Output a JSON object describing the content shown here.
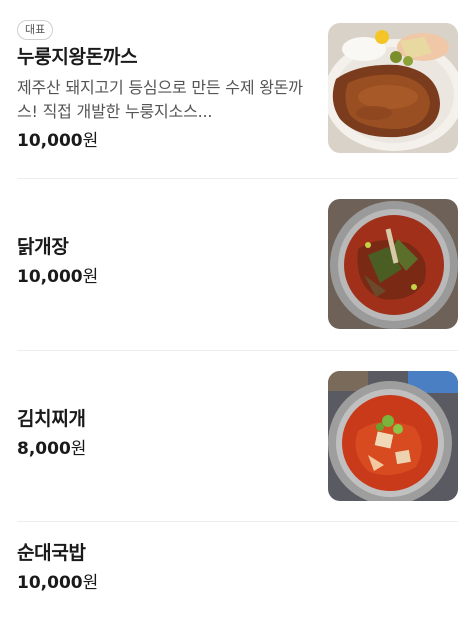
{
  "menu": {
    "items": [
      {
        "badge": "대표",
        "name": "누룽지왕돈까스",
        "description": "제주산 돼지고기 등심으로 만든 수제 왕돈까스! 직접 개발한 누룽지소스...",
        "price": "10,000",
        "unit": "원"
      },
      {
        "name": "닭개장",
        "price": "10,000",
        "unit": "원"
      },
      {
        "name": "김치찌개",
        "price": "8,000",
        "unit": "원"
      },
      {
        "name": "순대국밥",
        "price": "10,000",
        "unit": "원"
      }
    ]
  }
}
